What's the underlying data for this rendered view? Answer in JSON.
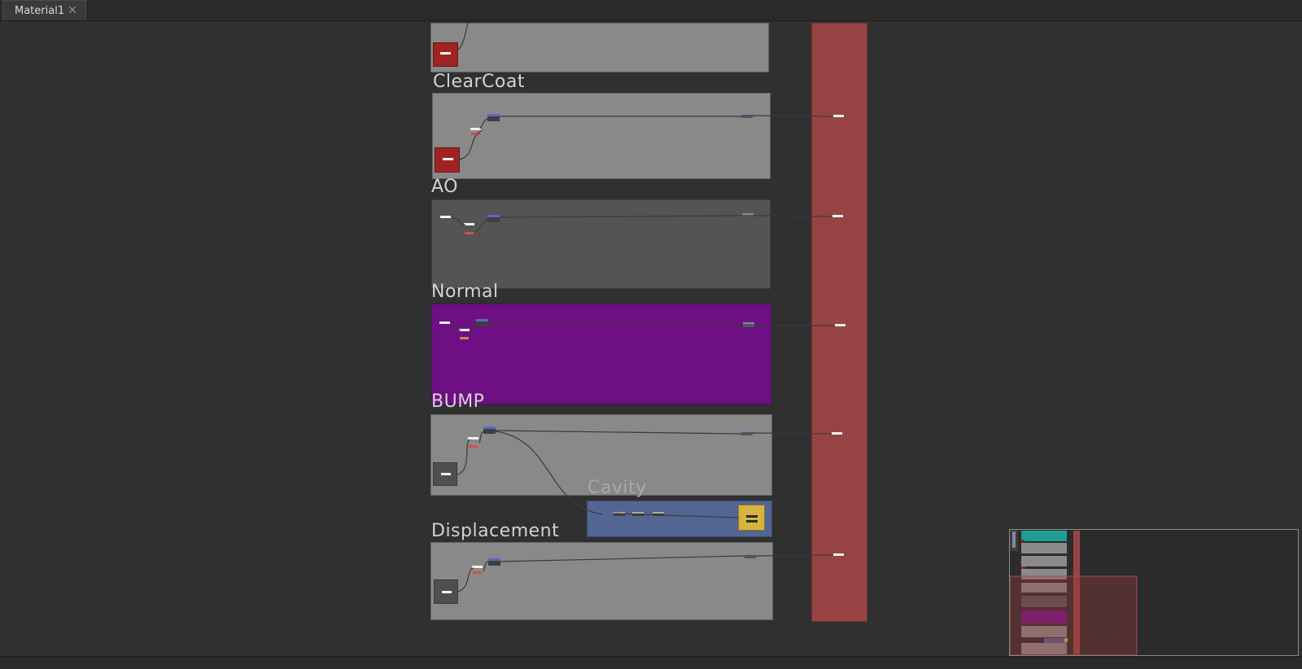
{
  "tab": {
    "label": "Material1",
    "close_glyph": "✕"
  },
  "frames": {
    "clearcoat": {
      "title": "ClearCoat"
    },
    "ao": {
      "title": "AO"
    },
    "normal": {
      "title": "Normal"
    },
    "bump": {
      "title": "BUMP"
    },
    "cavity": {
      "title": "Cavity"
    },
    "displacement": {
      "title": "Displacement"
    }
  },
  "colors": {
    "background": "#303030",
    "frame_gray": "#8a8a8a",
    "frame_dark": "#545454",
    "frame_purple": "#6e0f84",
    "frame_blue": "#526593",
    "output_red": "#984343",
    "node_red": "#9f2323",
    "node_yellow": "#d6b43e"
  },
  "icons": {
    "close": "close-icon"
  }
}
